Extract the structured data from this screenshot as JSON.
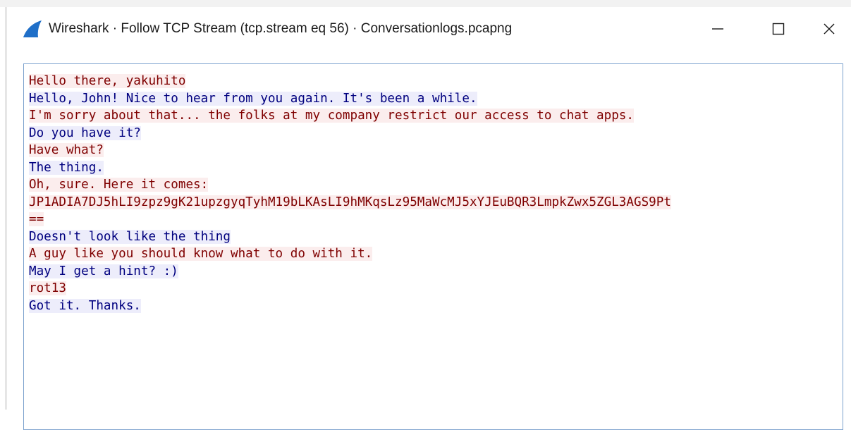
{
  "window": {
    "title": "Wireshark · Follow TCP Stream (tcp.stream eq 56) · Conversationlogs.pcapng"
  },
  "colors": {
    "client_text": "#7f0000",
    "client_bg": "#fbeded",
    "server_text": "#00007f",
    "server_bg": "#ededfb",
    "border": "#7da2ce",
    "wireshark_fin": "#1f6fc8"
  },
  "icons": {
    "app": "wireshark-fin-icon",
    "minimize": "minimize-icon",
    "maximize": "maximize-icon",
    "close": "close-icon"
  },
  "stream": {
    "lines": [
      {
        "side": "client",
        "text": "Hello there, yakuhito"
      },
      {
        "side": "server",
        "text": "Hello, John! Nice to hear from you again. It's been a while."
      },
      {
        "side": "client",
        "text": "I'm sorry about that... the folks at my company restrict our access to chat apps."
      },
      {
        "side": "server",
        "text": "Do you have it?"
      },
      {
        "side": "client",
        "text": "Have what?"
      },
      {
        "side": "server",
        "text": "The thing."
      },
      {
        "side": "client",
        "text": "Oh, sure. Here it comes:"
      },
      {
        "side": "client",
        "text": "JP1ADIA7DJ5hLI9zpz9gK21upzgyqTyhM19bLKAsLI9hMKqsLz95MaWcMJ5xYJEuBQR3LmpkZwx5ZGL3AGS9Pt"
      },
      {
        "side": "client",
        "text": "=="
      },
      {
        "side": "server",
        "text": "Doesn't look like the thing"
      },
      {
        "side": "client",
        "text": "A guy like you should know what to do with it."
      },
      {
        "side": "server",
        "text": "May I get a hint? :)"
      },
      {
        "side": "client",
        "text": "rot13"
      },
      {
        "side": "server",
        "text": "Got it. Thanks."
      }
    ]
  }
}
